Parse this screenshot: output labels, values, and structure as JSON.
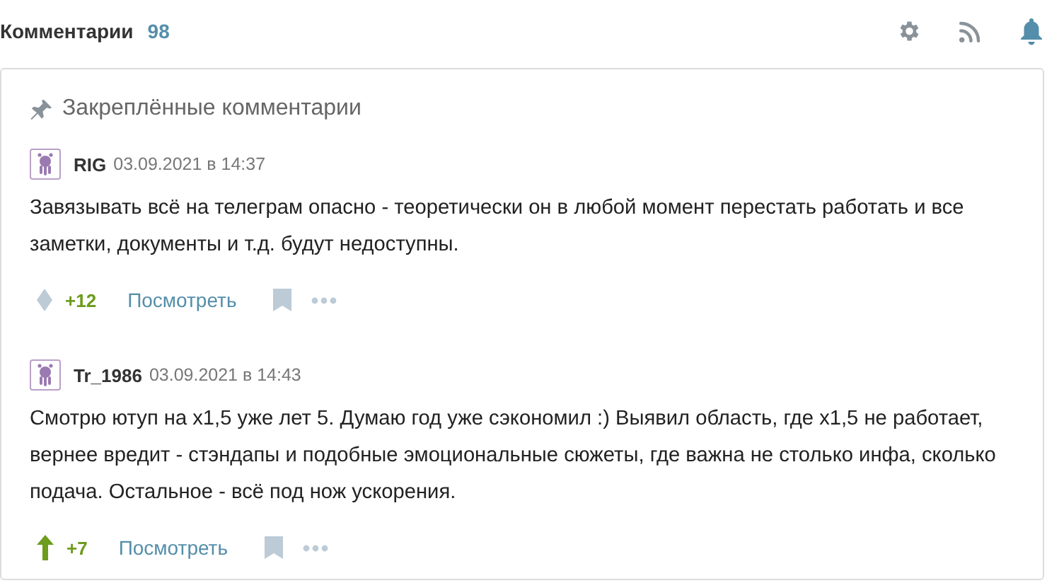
{
  "header": {
    "title": "Комментарии",
    "count": "98"
  },
  "pinned": {
    "title": "Закреплённые комментарии"
  },
  "comments": [
    {
      "author": "RIG",
      "date": "03.09.2021 в 14:37",
      "text": "Завязывать всё на телеграм опасно - теоретически он в любой момент перестать работать и все заметки, документы и т.д. будут недоступны.",
      "kind": "diamond",
      "score": "+12",
      "view": "Посмотреть"
    },
    {
      "author": "Tr_1986",
      "date": "03.09.2021 в 14:43",
      "text": "Смотрю ютуп на x1,5 уже лет 5. Думаю год уже сэкономил :) Выявил область, где x1,5 не работает, вернее вредит - стэндапы и подобные эмоциональные сюжеты, где важна не столько инфа, сколько подача. Остальное - всё под нож ускорения.",
      "kind": "arrow",
      "score": "+7",
      "view": "Посмотреть"
    }
  ]
}
